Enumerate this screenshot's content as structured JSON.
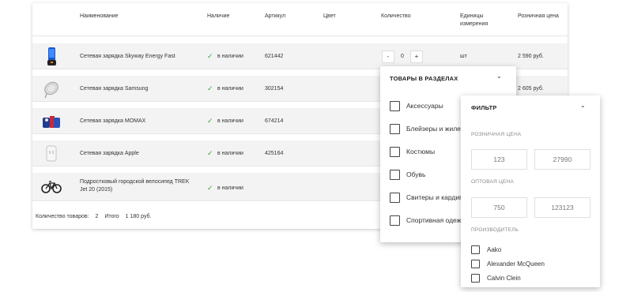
{
  "table": {
    "headers": {
      "name": "Наименование",
      "availability": "Наличие",
      "sku": "Артикул",
      "color": "Цвет",
      "quantity": "Количество",
      "units_line1": "Единицы",
      "units_line2": "измерения",
      "price": "Розничная цена"
    },
    "rows": [
      {
        "name": "Сетевая зарядка Skyway Energy Fast",
        "availability": "в наличии",
        "sku": "621442",
        "units": "шт",
        "price": "2 590 руб.",
        "qty": "0",
        "image": "blue-phone-charger"
      },
      {
        "name": "Сетевая зарядка Samsung",
        "availability": "в наличии",
        "sku": "302154",
        "price": "2 605 руб.",
        "image": "wireless-charger-pad"
      },
      {
        "name": "Сетевая зарядка MOMAX",
        "availability": "в наличии",
        "sku": "674214",
        "image": "charger-bundle"
      },
      {
        "name": "Сетевая зарядка Apple",
        "availability": "в наличии",
        "sku": "425164",
        "image": "white-adapter"
      },
      {
        "name_line1": "Подростковый городской велосипед TREK",
        "name_line2": "Jet 20 (2015)",
        "availability": "в наличии",
        "image": "bicycle"
      }
    ],
    "stepper": {
      "minus": "-",
      "plus": "+"
    },
    "footer": {
      "count_label": "Количество товаров:",
      "count_value": "2",
      "total_label": "Итого",
      "total_value": "1 180 руб."
    }
  },
  "sections_panel": {
    "title": "ТОВАРЫ В РАЗДЕЛАХ",
    "items": [
      "Аксессуары",
      "Блейзеры и жилеты",
      "Костюмы",
      "Обувь",
      "Свитеры и кардиганы",
      "Спортивная одежда"
    ]
  },
  "filter_panel": {
    "title": "ФИЛЬТР",
    "retail_label": "РОЗНИЧНАЯ ЦЕНА",
    "retail_min": "123",
    "retail_max": "27990",
    "wholesale_label": "ОПТОВАЯ ЦЕНА",
    "wholesale_min": "750",
    "wholesale_max": "123123",
    "brand_label": "ПРОИЗВОДИТЕЛЬ",
    "brands": [
      "Aako",
      "Alexander McQueen",
      "Calvin Clein"
    ]
  },
  "colors": {
    "check_green": "#3aa343"
  },
  "icons": {
    "available": "checkmark-icon",
    "dropdown": "chevron-down-icon"
  }
}
